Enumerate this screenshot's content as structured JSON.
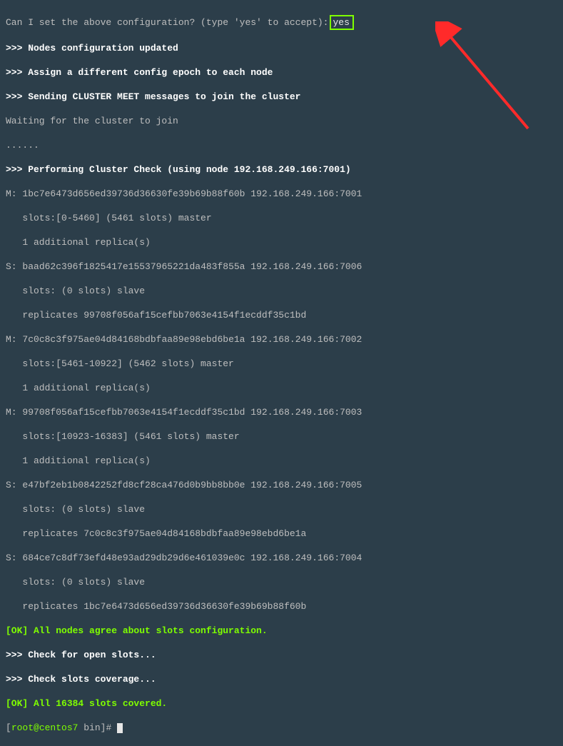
{
  "prompt": {
    "text": "Can I set the above configuration? (type 'yes' to accept):",
    "input": "yes"
  },
  "msg_updated": ">>> Nodes configuration updated",
  "msg_assign": ">>> Assign a different config epoch to each node",
  "msg_sending": ">>> Sending CLUSTER MEET messages to join the cluster",
  "msg_waiting": "Waiting for the cluster to join",
  "dots": "......",
  "msg_check_header": ">>> Performing Cluster Check (using node 192.168.249.166:7001)",
  "nodes": {
    "n1": {
      "role": "M:",
      "id": "1bc7e6473d656ed39736d36630fe39b69b88f60b",
      "addr": "192.168.249.166:7001",
      "slots": "   slots:[0-5460] (5461 slots) master",
      "extra": "   1 additional replica(s)"
    },
    "n2": {
      "role": "S:",
      "id": "baad62c396f1825417e15537965221da483f855a",
      "addr": "192.168.249.166:7006",
      "slots": "   slots: (0 slots) slave",
      "extra": "   replicates 99708f056af15cefbb7063e4154f1ecddf35c1bd"
    },
    "n3": {
      "role": "M:",
      "id": "7c0c8c3f975ae04d84168bdbfaa89e98ebd6be1a",
      "addr": "192.168.249.166:7002",
      "slots": "   slots:[5461-10922] (5462 slots) master",
      "extra": "   1 additional replica(s)"
    },
    "n4": {
      "role": "M:",
      "id": "99708f056af15cefbb7063e4154f1ecddf35c1bd",
      "addr": "192.168.249.166:7003",
      "slots": "   slots:[10923-16383] (5461 slots) master",
      "extra": "   1 additional replica(s)"
    },
    "n5": {
      "role": "S:",
      "id": "e47bf2eb1b0842252fd8cf28ca476d0b9bb8bb0e",
      "addr": "192.168.249.166:7005",
      "slots": "   slots: (0 slots) slave",
      "extra": "   replicates 7c0c8c3f975ae04d84168bdbfaa89e98ebd6be1a"
    },
    "n6": {
      "role": "S:",
      "id": "684ce7c8df73efd48e93ad29db29d6e461039e0c",
      "addr": "192.168.249.166:7004",
      "slots": "   slots: (0 slots) slave",
      "extra": "   replicates 1bc7e6473d656ed39736d36630fe39b69b88f60b"
    }
  },
  "ok_agree": "[OK] All nodes agree about slots configuration.",
  "msg_open": ">>> Check for open slots...",
  "msg_cov": ">>> Check slots coverage...",
  "ok_cov": "[OK] All 16384 slots covered.",
  "shell": {
    "open": "[",
    "user": "root@centos7",
    "cwd": " bin",
    "close": "]# "
  }
}
